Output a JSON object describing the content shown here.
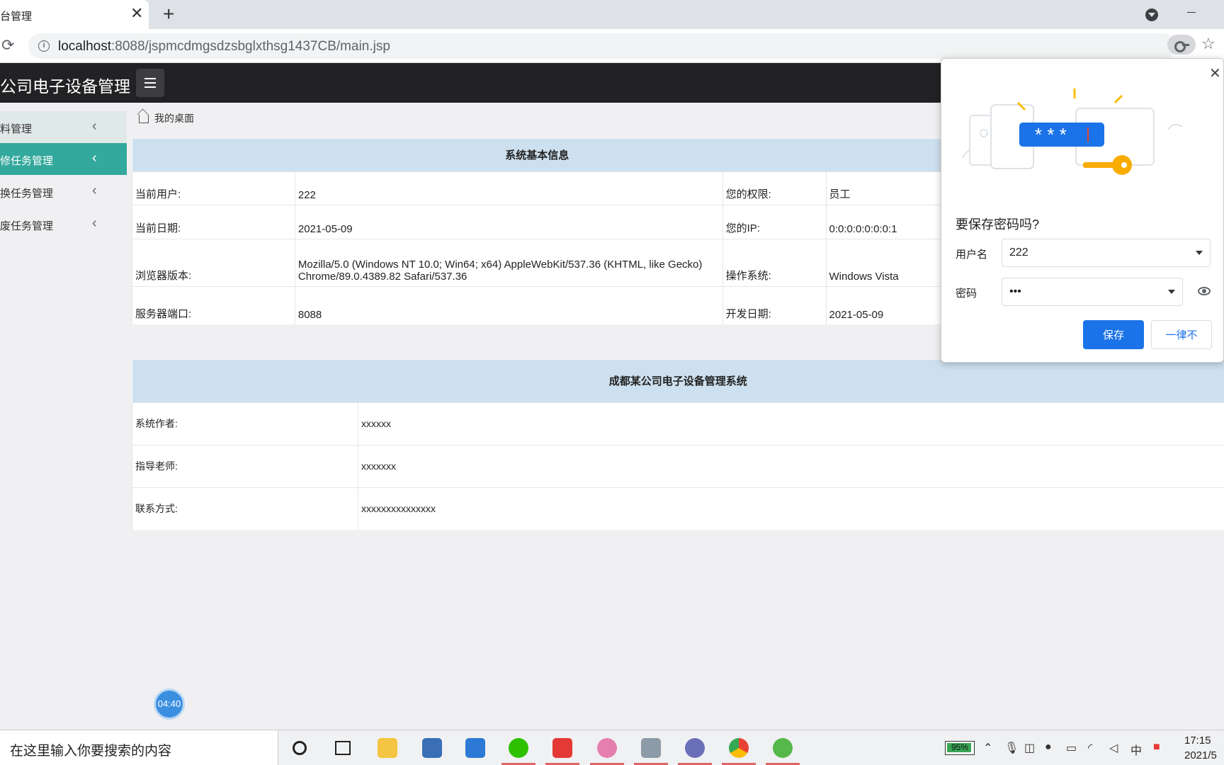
{
  "browser": {
    "tab_title": "台管理",
    "tab_close": "✕",
    "new_tab": "+",
    "url_host": "localhost",
    "url_rest": ":8088/jspmcdmgsdzsbglxthsg1437CB/main.jsp",
    "reload": "⟳",
    "star": "☆"
  },
  "header": {
    "title": "公司电子设备管理"
  },
  "sidebar": {
    "items": [
      {
        "label": "料管理"
      },
      {
        "label": "修任务管理"
      },
      {
        "label": "换任务管理"
      },
      {
        "label": "废任务管理"
      }
    ],
    "chevron": "‹",
    "timer": "04:40"
  },
  "breadcrumb": "我的桌面",
  "sysinfo": {
    "heading": "系统基本信息",
    "rows": [
      {
        "l1": "当前用户:",
        "v1": "222",
        "l2": "您的权限:",
        "v2": "员工"
      },
      {
        "l1": "当前日期:",
        "v1": "2021-05-09",
        "l2": "您的IP:",
        "v2": "0:0:0:0:0:0:0:1"
      },
      {
        "l1": "浏览器版本:",
        "v1": "Mozilla/5.0 (Windows NT 10.0; Win64; x64) AppleWebKit/537.36 (KHTML, like Gecko) Chrome/89.0.4389.82 Safari/537.36",
        "l2": "操作系统:",
        "v2": "Windows Vista"
      },
      {
        "l1": "服务器端口:",
        "v1": "8088",
        "l2": "开发日期:",
        "v2": "2021-05-09"
      }
    ]
  },
  "system": {
    "heading": "成都某公司电子设备管理系统",
    "rows": [
      {
        "label": "系统作者:",
        "value": "xxxxxx"
      },
      {
        "label": "指导老师:",
        "value": "xxxxxxx"
      },
      {
        "label": "联系方式:",
        "value": "xxxxxxxxxxxxxxx"
      }
    ]
  },
  "password_popup": {
    "title": "要保存密码吗?",
    "username_label": "用户名",
    "username_value": "222",
    "password_label": "密码",
    "password_value": "•••",
    "save": "保存",
    "never": "一律不",
    "close": "✕"
  },
  "taskbar": {
    "search_placeholder": "在这里输入你要搜索的内容",
    "battery": "95%",
    "ime": "中",
    "time": "17:15",
    "date": "2021/5"
  }
}
